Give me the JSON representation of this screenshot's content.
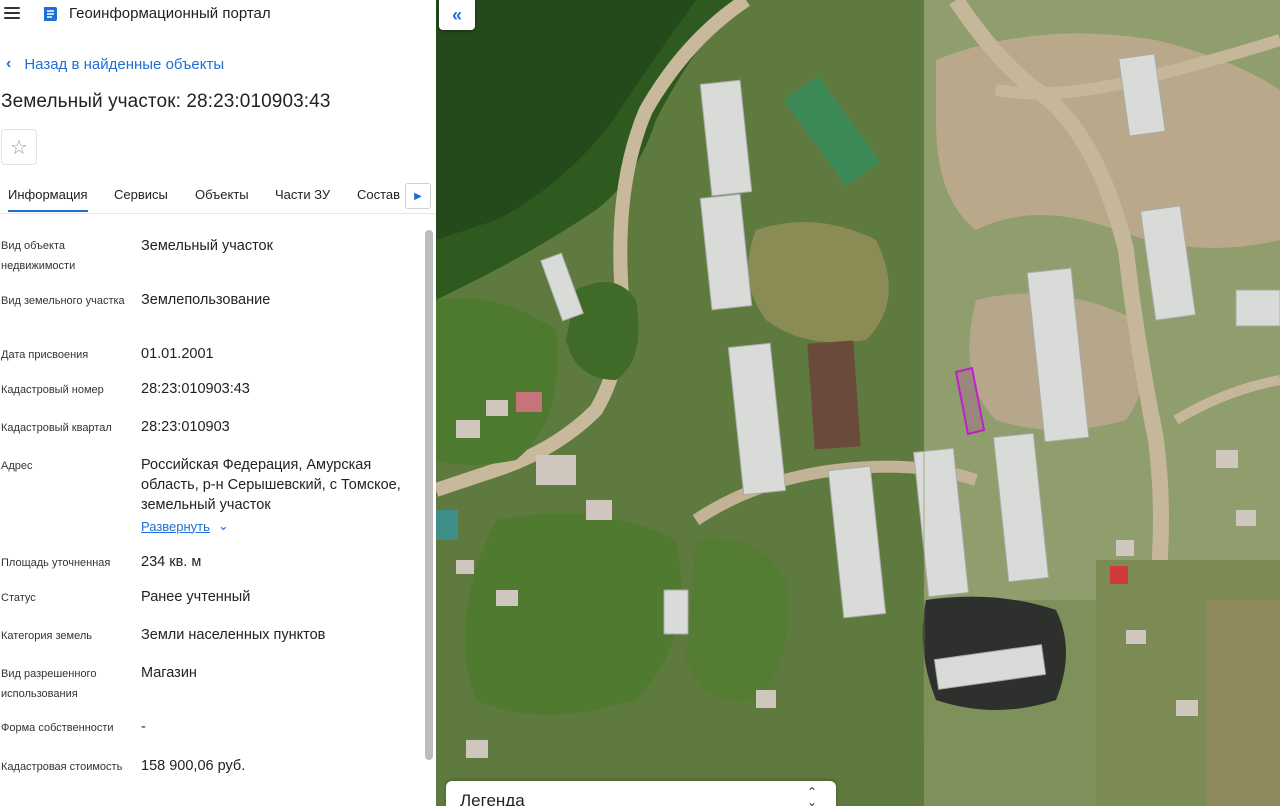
{
  "header": {
    "app_title": "Геоинформационный портал",
    "menu_icon": "hamburger-menu-icon",
    "logo_icon": "portal-logo-icon"
  },
  "back_link": {
    "label": "Назад в найденные объекты",
    "icon": "chevron-left-icon"
  },
  "parcel": {
    "title": "Земельный участок: 28:23:010903:43"
  },
  "favorite": {
    "icon": "star-outline-icon"
  },
  "tabs": [
    {
      "label": "Информация",
      "active": true
    },
    {
      "label": "Сервисы",
      "active": false
    },
    {
      "label": "Объекты",
      "active": false
    },
    {
      "label": "Части ЗУ",
      "active": false
    },
    {
      "label": "Состав",
      "active": false
    }
  ],
  "tab_scroll_icon": "chevron-right-icon",
  "properties": [
    {
      "label": "Вид объекта недвижимости",
      "value": "Земельный участок"
    },
    {
      "label": "Вид земельного участка",
      "value": "Землепользование"
    },
    {
      "label": "Дата присвоения",
      "value": "01.01.2001"
    },
    {
      "label": "Кадастровый номер",
      "value": "28:23:010903:43"
    },
    {
      "label": "Кадастровый квартал",
      "value": "28:23:010903"
    },
    {
      "label": "Адрес",
      "value": "Российская Федерация, Амурская область, р-н Серышевский, с Томское, земельный участок"
    },
    {
      "label": "Площадь уточненная",
      "value": "234 кв. м"
    },
    {
      "label": "Статус",
      "value": "Ранее учтенный"
    },
    {
      "label": "Категория земель",
      "value": "Земли населенных пунктов"
    },
    {
      "label": "Вид разрешенного использования",
      "value": "Магазин"
    },
    {
      "label": "Форма собственности",
      "value": "-"
    },
    {
      "label": "Кадастровая стоимость",
      "value": "158 900,06 руб."
    }
  ],
  "address_expand": {
    "label": "Развернуть",
    "icon": "chevron-down-icon"
  },
  "map": {
    "collapse_icon": "double-chevron-left-icon",
    "legend_title": "Легенда",
    "legend_toggle_icon": "expand-collapse-icon",
    "highlight_color": "#c21fc8"
  }
}
